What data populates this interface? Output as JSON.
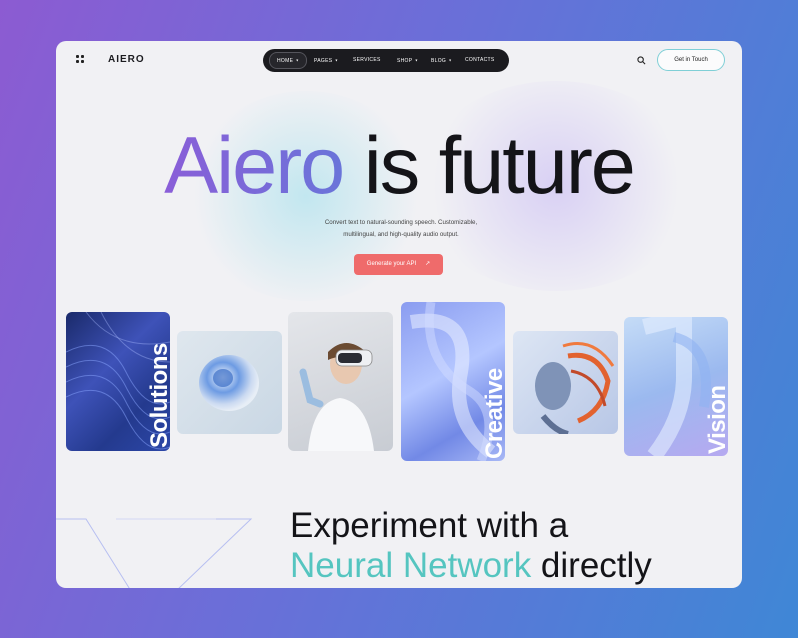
{
  "header": {
    "logo": "AIERO",
    "nav": [
      {
        "label": "HOME",
        "caret": true
      },
      {
        "label": "PAGES",
        "caret": true
      },
      {
        "label": "SERVICES",
        "caret": false
      },
      {
        "label": "SHOP",
        "caret": true
      },
      {
        "label": "BLOG",
        "caret": true
      },
      {
        "label": "CONTACTS",
        "caret": false
      }
    ],
    "cta_label": "Get in Touch"
  },
  "hero": {
    "title_highlight": "Aiero",
    "title_rest": " is future",
    "subtitle_line1": "Convert text to natural-sounding speech. Customizable,",
    "subtitle_line2": "multilingual, and high-quality audio output.",
    "button_label": "Generate your API",
    "button_arrow": "↗"
  },
  "gallery": {
    "words": [
      "Solutions",
      "Creative",
      "Vision"
    ]
  },
  "section": {
    "line1": "Experiment with a",
    "line2_highlight": "Neural Network",
    "line2_rest": " directly"
  },
  "colors": {
    "accent_purple": "#8a5ed8",
    "accent_teal": "#55c5c0",
    "cta_red": "#ef6b6b",
    "nav_dark": "#1b1b1f"
  },
  "icons": [
    "grid-menu-icon",
    "search-icon",
    "chevron-down-icon",
    "arrow-up-right-icon"
  ]
}
